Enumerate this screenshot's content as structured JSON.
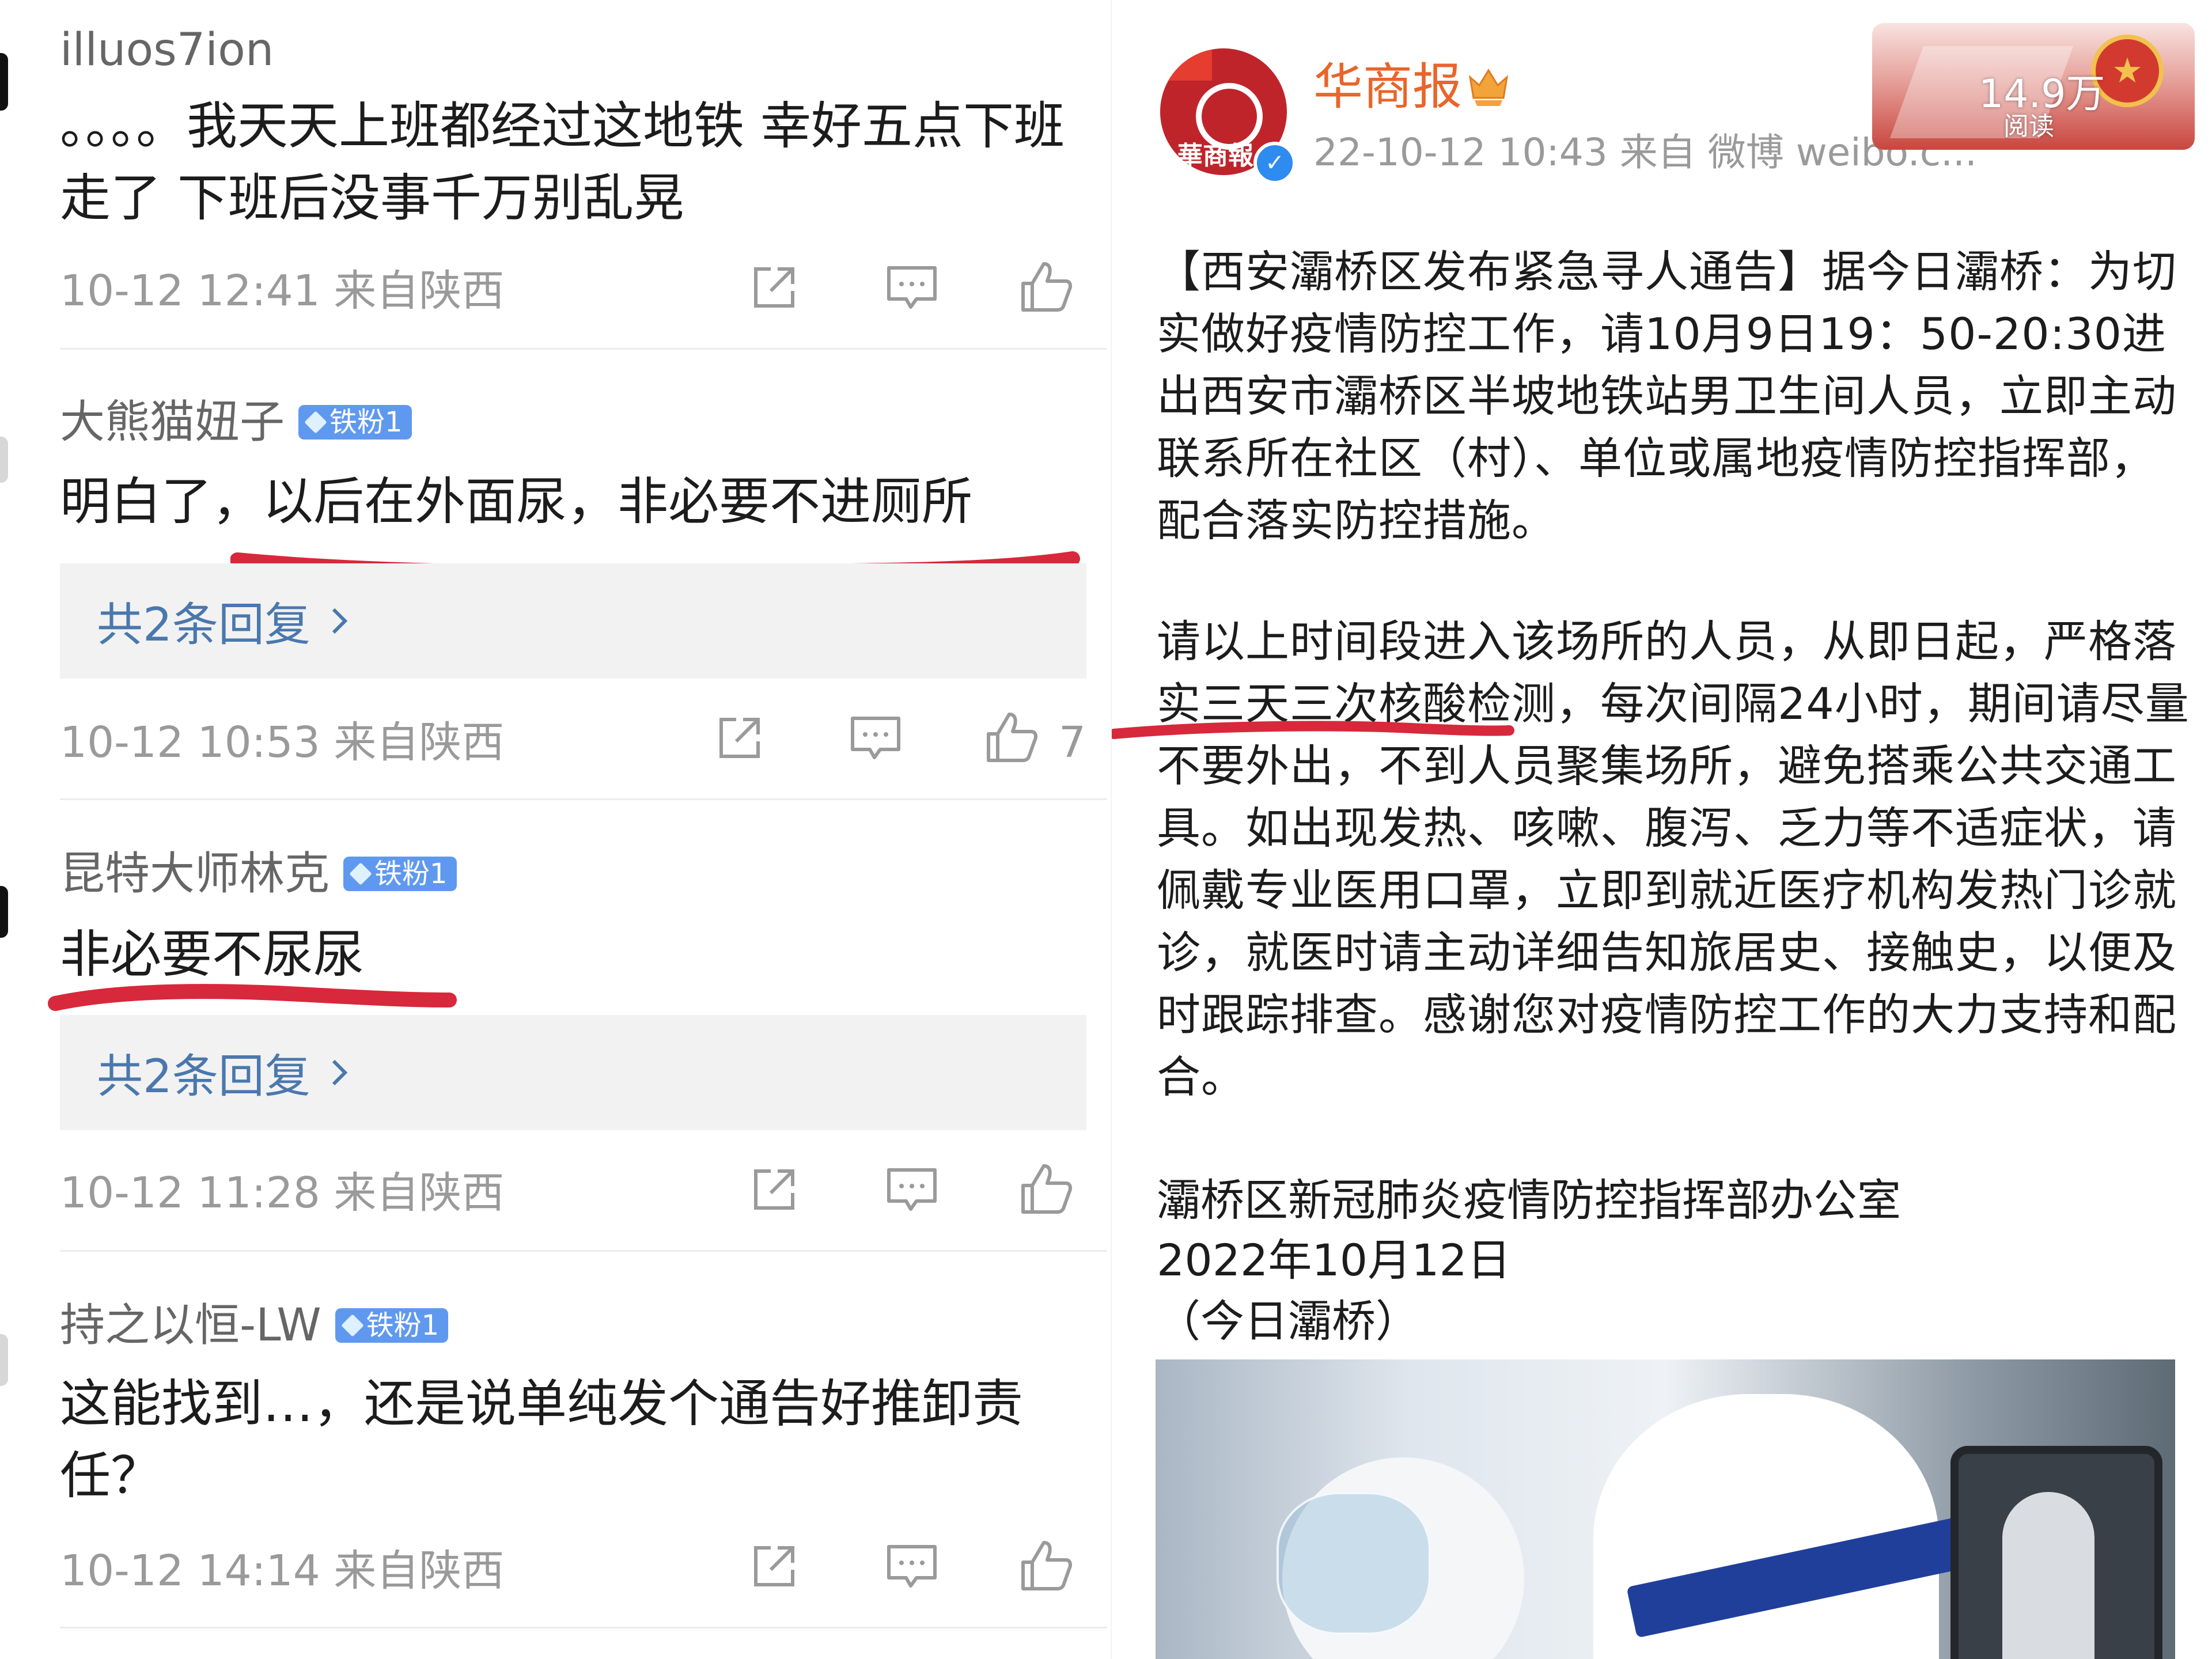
{
  "comments": [
    {
      "author": "illuos7ion",
      "text": "。。。。我天天上班都经过这地铁 幸好五点下班走了 下班后没事千万别乱晃",
      "meta": "10-12 12:41 来自陕西"
    },
    {
      "author": "大熊猫妞子",
      "badge": "铁粉1",
      "text": "明白了，以后在外面尿，非必要不进厕所",
      "replies": "共2条回复",
      "meta": "10-12 10:53 来自陕西",
      "likes": "7"
    },
    {
      "author": "昆特大师林克",
      "badge": "铁粉1",
      "text": "非必要不尿尿",
      "replies": "共2条回复",
      "meta": "10-12 11:28 来自陕西"
    },
    {
      "author": "持之以恒-LW",
      "badge": "铁粉1",
      "text": "这能找到…，还是说单纯发个通告好推卸责任？",
      "meta": "10-12 14:14 来自陕西"
    }
  ],
  "post": {
    "account": "华商报",
    "avatar_text": "華商報",
    "meta": "22-10-12 10:43  来自 微博 weibo.c...",
    "reads": "14.9万",
    "reads_label": "阅读",
    "paragraph1": "【西安灞桥区发布紧急寻人通告】据今日灞桥：为切实做好疫情防控工作，请10月9日19：50-20:30进出西安市灞桥区半坡地铁站男卫生间人员，立即主动联系所在社区（村）、单位或属地疫情防控指挥部，配合落实防控措施。",
    "paragraph2": "请以上时间段进入该场所的人员，从即日起，严格落实三天三次核酸检测，每次间隔24小时，期间请尽量不要外出，不到人员聚集场所，避免搭乘公共交通工具。如出现发热、咳嗽、腹泻、乏力等不适症状，请佩戴专业医用口罩，立即到就近医疗机构发热门诊就诊，就医时请主动详细告知旅居史、接触史，以便及时跟踪排查。感谢您对疫情防控工作的大力支持和配合。",
    "signature": "灞桥区新冠肺炎疫情防控指挥部办公室",
    "date": "2022年10月12日",
    "source": "（今日灞桥）"
  },
  "colors": {
    "annotation_red": "#d8283b",
    "link_blue": "#4a78ad",
    "account_orange": "#e8652b",
    "badge_blue": "#5f99ef",
    "meta_gray": "#9a9a9a"
  }
}
